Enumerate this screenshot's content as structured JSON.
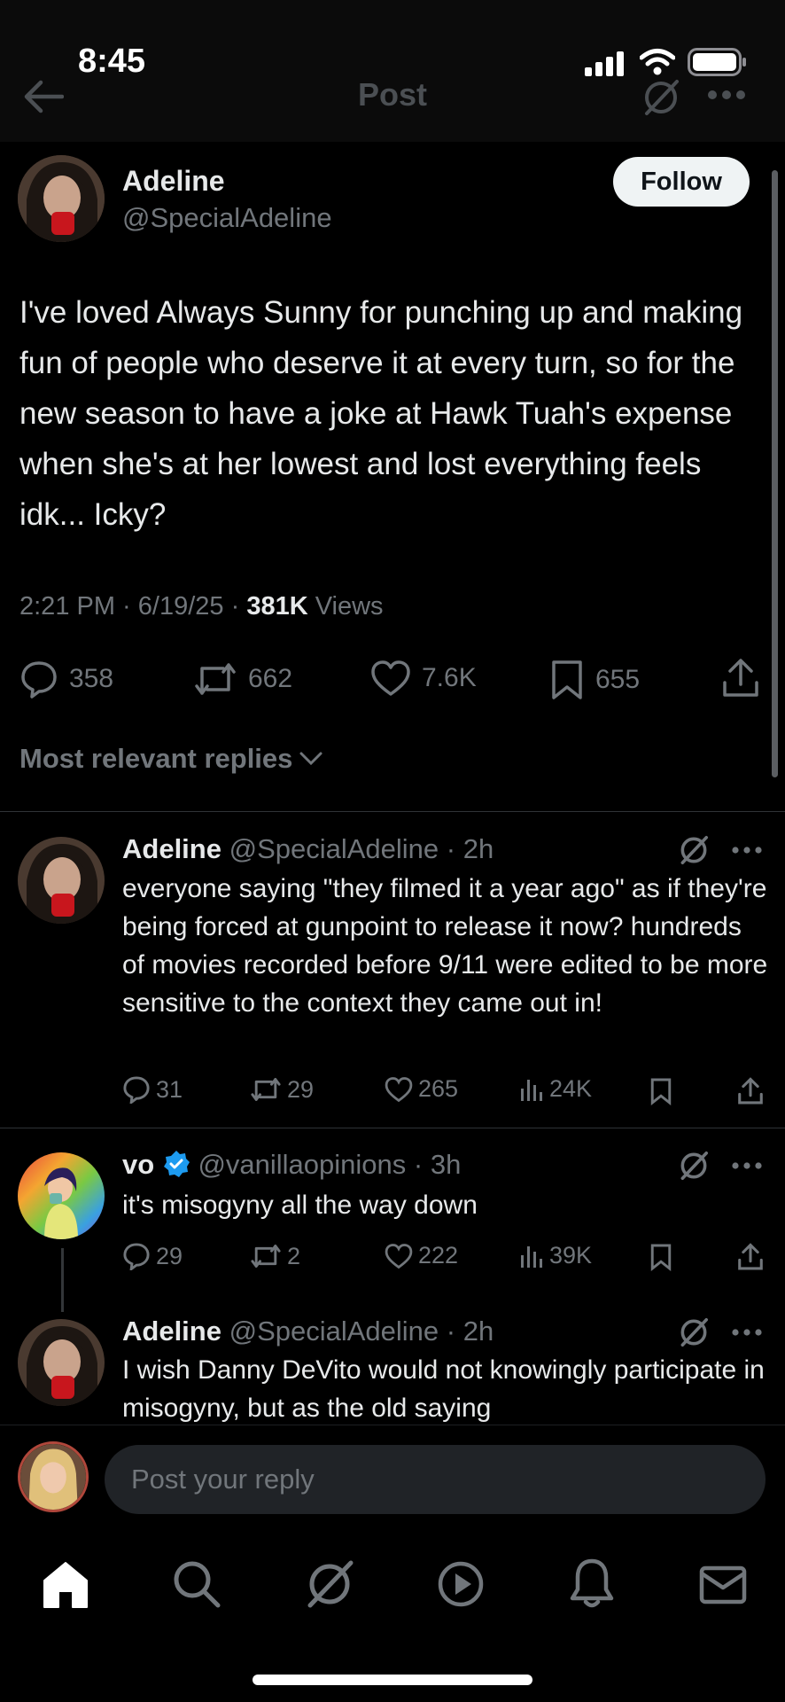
{
  "status_bar": {
    "time": "8:45"
  },
  "header": {
    "title": "Post"
  },
  "post": {
    "author_name": "Adeline",
    "author_handle": "@SpecialAdeline",
    "follow_label": "Follow",
    "text": "I've loved Always Sunny for punching up and making fun of people who deserve it at every turn, so for the new season to have a joke at Hawk Tuah's expense when she's at her lowest and lost everything feels idk... Icky?",
    "time": "2:21 PM",
    "date": "6/19/25",
    "views_count": "381K",
    "views_label": "Views",
    "replies": "358",
    "reposts": "662",
    "likes": "7.6K",
    "bookmarks": "655"
  },
  "replies_sort": {
    "label": "Most relevant replies"
  },
  "replies": [
    {
      "name": "Adeline",
      "handle": "@SpecialAdeline",
      "time": "2h",
      "text": "everyone saying \"they filmed it a year ago\" as if they're being forced at gunpoint to release it now? hundreds of movies recorded before 9/11 were edited to be more sensitive to the context they came out in!",
      "replies": "31",
      "reposts": "29",
      "likes": "265",
      "views": "24K"
    },
    {
      "name": "vo",
      "verified": true,
      "handle": "@vanillaopinions",
      "time": "3h",
      "text": "it's misogyny all the way down",
      "replies": "29",
      "reposts": "2",
      "likes": "222",
      "views": "39K"
    },
    {
      "name": "Adeline",
      "handle": "@SpecialAdeline",
      "time": "2h",
      "text": "I wish Danny DeVito would not knowingly participate in misogyny, but as the old saying"
    }
  ],
  "composer": {
    "placeholder": "Post your reply"
  },
  "tabbar": {
    "items": [
      "home",
      "search",
      "grok",
      "video",
      "notifications",
      "messages"
    ]
  },
  "colors": {
    "background": "#000000",
    "text": "#e7e9ea",
    "muted": "#71767b",
    "verified": "#1d9bf0",
    "divider": "#2f3336"
  },
  "icons": [
    "back-arrow-icon",
    "grok-icon",
    "more-icon",
    "reply-icon",
    "repost-icon",
    "like-icon",
    "bookmark-icon",
    "share-icon",
    "views-icon",
    "verified-badge-icon"
  ]
}
